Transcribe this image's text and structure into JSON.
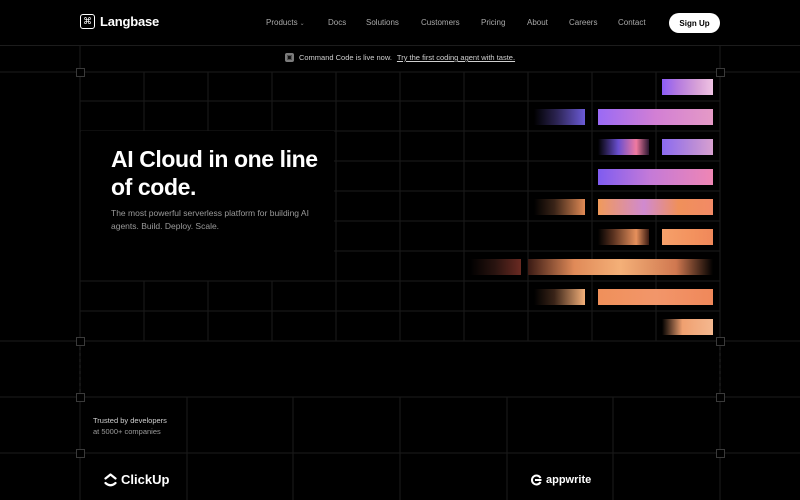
{
  "nav": {
    "logo_text": "Langbase",
    "logo_icon": "command-icon",
    "items": [
      {
        "label": "Products",
        "has_dropdown": true
      },
      {
        "label": "Docs"
      },
      {
        "label": "Solutions"
      },
      {
        "label": "Customers"
      },
      {
        "label": "Pricing"
      },
      {
        "label": "About"
      },
      {
        "label": "Careers"
      },
      {
        "label": "Contact"
      }
    ],
    "signup_label": "Sign Up"
  },
  "announcement": {
    "text": "Command Code is live now.",
    "link_text": "Try the first coding agent with taste."
  },
  "hero": {
    "title": "AI Cloud in one line of code.",
    "subtitle": "The most powerful serverless platform for building AI agents. Build. Deploy. Scale."
  },
  "trusted": {
    "line1": "Trusted by developers",
    "line2": "at 5000+ companies"
  },
  "logos": [
    {
      "name": "ClickUp",
      "icon": "clickup-chevron-icon"
    },
    {
      "name": "appwrite",
      "icon": "appwrite-icon"
    }
  ],
  "colors": {
    "background": "#000000",
    "purple": "#8b5cf6",
    "pink": "#ec6fb0",
    "orange": "#f0905a"
  }
}
